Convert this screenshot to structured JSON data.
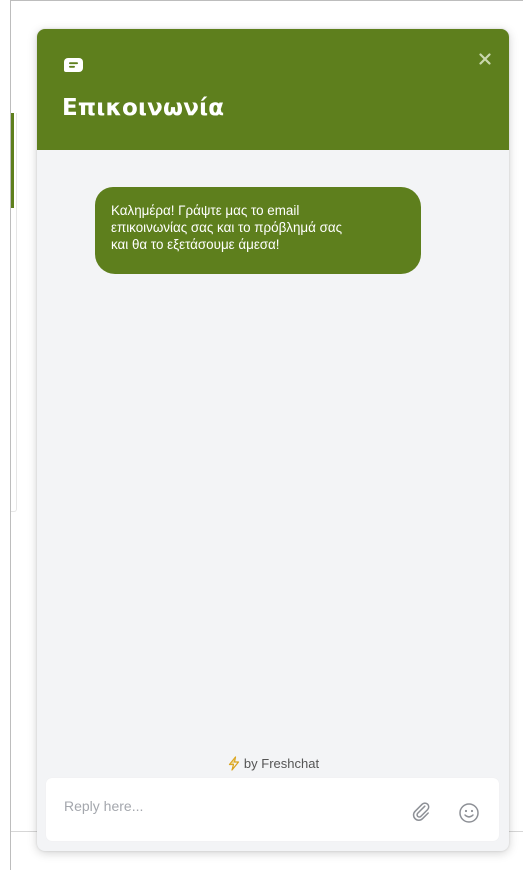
{
  "widget": {
    "title": "Επικοινωνία",
    "header_color": "#5e7f1d",
    "header_icon": "chat-bubble-icon",
    "close_icon": "close-icon",
    "close_glyph": "✕"
  },
  "messages": [
    {
      "sender": "agent",
      "lines": [
        "Καλημέρα! Γράψτε μας το email",
        "επικοινωνίας σας και το πρόβλημά σας",
        "και θα το εξετάσουμε άμεσα!"
      ],
      "bubble_color": "#5e7f1d"
    }
  ],
  "footer": {
    "powered_by": "by Freshchat",
    "bolt_icon": "lightning-bolt-icon"
  },
  "composer": {
    "placeholder": "Reply here...",
    "value": "",
    "attach_icon": "paperclip-icon",
    "emoji_icon": "smiley-icon"
  }
}
